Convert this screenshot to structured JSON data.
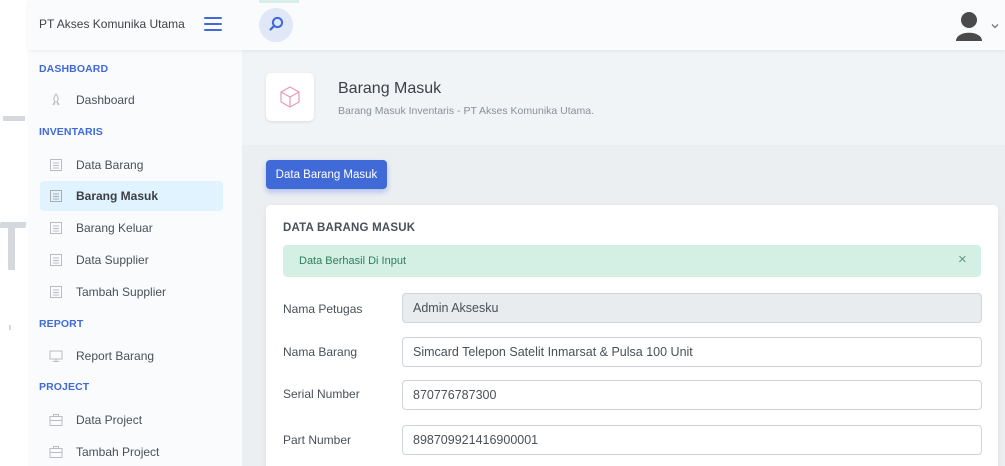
{
  "app": {
    "brand": "PT Akses Komunika Utama"
  },
  "sidebar": {
    "sections": [
      {
        "title": "DASHBOARD",
        "items": [
          {
            "label": "Dashboard",
            "icon": "rocket-icon"
          }
        ]
      },
      {
        "title": "INVENTARIS",
        "items": [
          {
            "label": "Data Barang",
            "icon": "box-icon"
          },
          {
            "label": "Barang Masuk",
            "icon": "box-icon",
            "active": true
          },
          {
            "label": "Barang Keluar",
            "icon": "box-icon"
          },
          {
            "label": "Data Supplier",
            "icon": "box-icon"
          },
          {
            "label": "Tambah Supplier",
            "icon": "box-icon"
          }
        ]
      },
      {
        "title": "REPORT",
        "items": [
          {
            "label": "Report Barang",
            "icon": "monitor-icon"
          }
        ]
      },
      {
        "title": "PROJECT",
        "items": [
          {
            "label": "Data Project",
            "icon": "briefcase-icon"
          },
          {
            "label": "Tambah Project",
            "icon": "briefcase-icon"
          }
        ]
      }
    ]
  },
  "page": {
    "title": "Barang Masuk",
    "subtitle": "Barang Masuk Inventaris - PT Akses Komunika Utama.",
    "icon": "cube-icon"
  },
  "tab": {
    "label": "Data Barang Masuk"
  },
  "card": {
    "title": "DATA BARANG MASUK",
    "alert": {
      "text": "Data Berhasil Di Input",
      "close": "×"
    },
    "fields": [
      {
        "label": "Nama Petugas",
        "value": "Admin Aksesku",
        "readonly": true
      },
      {
        "label": "Nama Barang",
        "value": "Simcard Telepon Satelit Inmarsat & Pulsa 100 Unit"
      },
      {
        "label": "Serial Number",
        "value": "870776787300"
      },
      {
        "label": "Part Number",
        "value": "898709921416900001"
      }
    ]
  },
  "colors": {
    "accent": "#3f6ad8",
    "alert_bg": "#d4f0e5",
    "alert_text": "#2d7d5d",
    "active_bg": "#e0f3ff"
  }
}
